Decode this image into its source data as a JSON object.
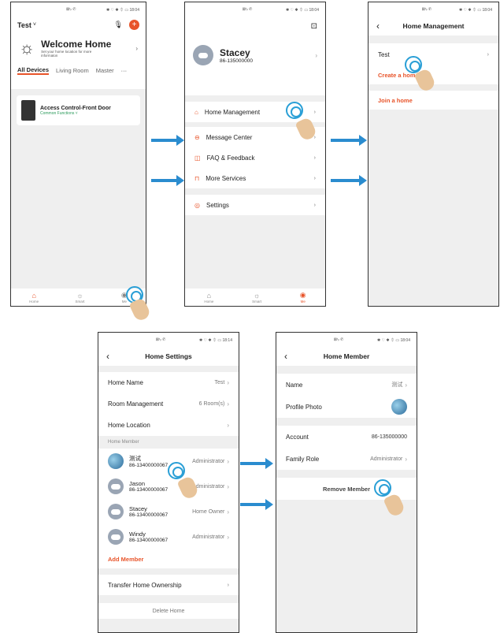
{
  "status": {
    "left": "⊠ᵗᵢₗ ✆",
    "right": "✱ ♡ ✱ ⏀ ▭ 18:04",
    "right_b": "✱ ♡ ✱ ⏀ ▭ 18:14"
  },
  "screen1": {
    "home_name": "Test",
    "welcome_title": "Welcome Home",
    "welcome_sub": "Set your home location for more informaton",
    "tabs": [
      "All Devices",
      "Living Room",
      "Master",
      "···"
    ],
    "device_name": "Access Control-Front Door",
    "device_sub": "Common Functions ˅",
    "tabbar": [
      "Home",
      "Smart",
      "Me"
    ]
  },
  "screen2": {
    "user_name": "Stacey",
    "user_phone": "86-135000000",
    "menu": [
      "Home Management",
      "Message Center",
      "FAQ & Feedback",
      "More Services",
      "Settings"
    ],
    "tabbar": [
      "Home",
      "Smart",
      "Me"
    ]
  },
  "screen3": {
    "title": "Home Management",
    "home_item": "Test",
    "create": "Create a home",
    "join": "Join a home"
  },
  "screen4": {
    "title": "Home Settings",
    "rows": [
      {
        "label": "Home Name",
        "value": "Test"
      },
      {
        "label": "Room Management",
        "value": "6 Room(s)"
      },
      {
        "label": "Home Location",
        "value": ""
      }
    ],
    "section": "Home Member",
    "members": [
      {
        "name": "测试",
        "phone": "86-13400000067",
        "role": "Administrator"
      },
      {
        "name": "Jason",
        "phone": "86-13400000067",
        "role": "Administrator"
      },
      {
        "name": "Stacey",
        "phone": "86-13400000067",
        "role": "Home Owner"
      },
      {
        "name": "Windy",
        "phone": "86-13400000067",
        "role": "Administrator"
      }
    ],
    "add_member": "Add Member",
    "transfer": "Transfer Home Ownership",
    "delete": "Delete Home"
  },
  "screen5": {
    "title": "Home Member",
    "name_label": "Name",
    "name_value": "测试",
    "photo_label": "Profile Photo",
    "account_label": "Account",
    "account_value": "86-135000000",
    "role_label": "Family Role",
    "role_value": "Administrator",
    "remove": "Remove Member"
  }
}
